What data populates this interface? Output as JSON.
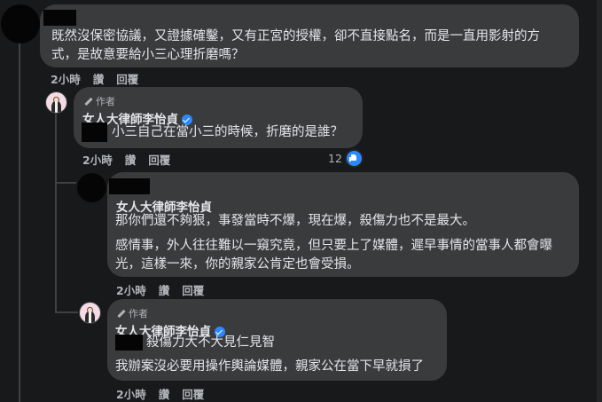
{
  "comment1": {
    "text_line1": "既然沒保密協議，又證據確鑿，又有正宮的授權，卻不直接點名，而是一直用影射的方",
    "text_line2": "式，是故意要給小三心理折磨嗎？",
    "time": "2小時",
    "like_label": "讚",
    "reply_label": "回覆"
  },
  "reply1": {
    "author_badge": "作者",
    "name": "女人大律師李怡貞",
    "text": "小三自己在當小三的時候，折磨的是誰？",
    "time": "2小時",
    "like_label": "讚",
    "reply_label": "回覆",
    "reaction_count": "12"
  },
  "reply2": {
    "name": "女人大律師李怡貞",
    "line1": "那你們還不夠狠，事發當時不爆，現在爆，殺傷力也不是最大。",
    "line2": "感情事，外人往往難以一窺究竟，但只要上了媒體，遲早事情的當事人都會曝",
    "line3": "光，這樣一來，你的親家公肯定也會受損。",
    "time": "2小時",
    "like_label": "讚",
    "reply_label": "回覆"
  },
  "reply3": {
    "author_badge": "作者",
    "name": "女人大律師李怡貞",
    "line1": "殺傷力大不大見仁見智",
    "line2": "我辦案沒必要用操作輿論媒體，親家公在當下早就損了",
    "time": "2小時",
    "like_label": "讚",
    "reply_label": "回覆"
  }
}
